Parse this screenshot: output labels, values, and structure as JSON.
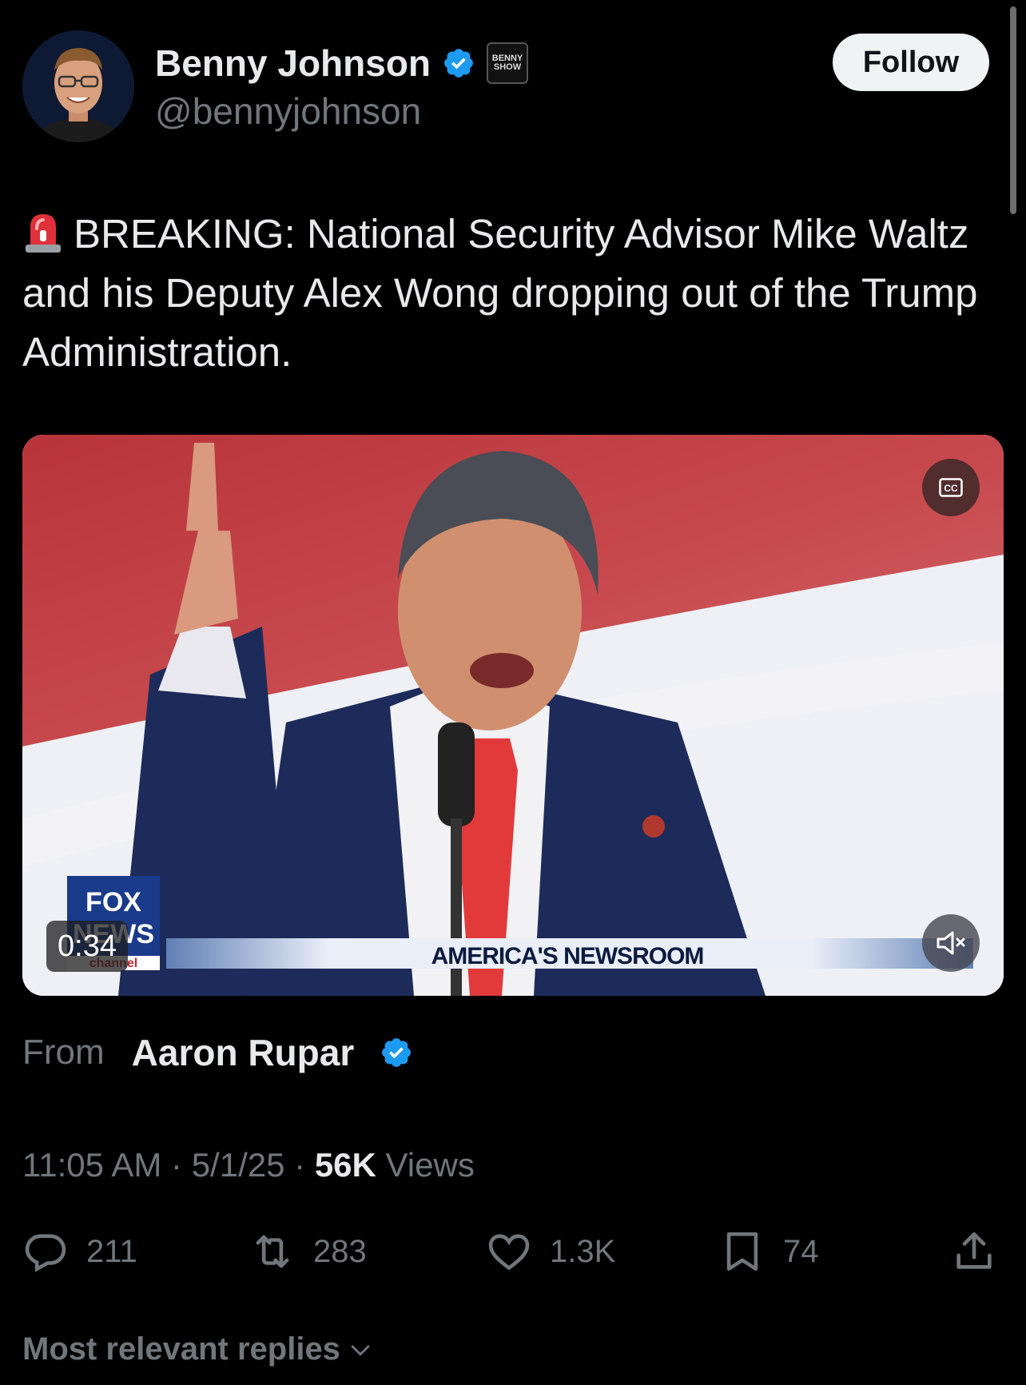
{
  "author": {
    "name": "Benny Johnson",
    "handle": "@bennyjohnson",
    "affiliate_badge": "BENNY SHOW",
    "avatar_icon": "avatar"
  },
  "follow_label": "Follow",
  "tweet": {
    "emoji_icon": "police-siren-icon",
    "text": "BREAKING: National Security Advisor Mike Waltz and his Deputy Alex Wong dropping out of the Trump Administration."
  },
  "video": {
    "duration": "0:34",
    "chyron": "AMERICA'S NEWSROOM",
    "network_logo": [
      "FOX",
      "NEWS",
      "channel"
    ],
    "cc_label": "CC"
  },
  "source": {
    "from_label": "From",
    "name": "Aaron Rupar"
  },
  "meta": {
    "time": "11:05 AM",
    "separator": "·",
    "date": "5/1/25",
    "views_count": "56K",
    "views_label": "Views"
  },
  "actions": {
    "replies": "211",
    "reposts": "283",
    "likes": "1.3K",
    "bookmarks": "74"
  },
  "replies_sort_label": "Most relevant replies",
  "colors": {
    "background": "#000000",
    "text_primary": "#e7e9ea",
    "text_secondary": "#71767b",
    "verified_blue": "#1d9bf0"
  }
}
